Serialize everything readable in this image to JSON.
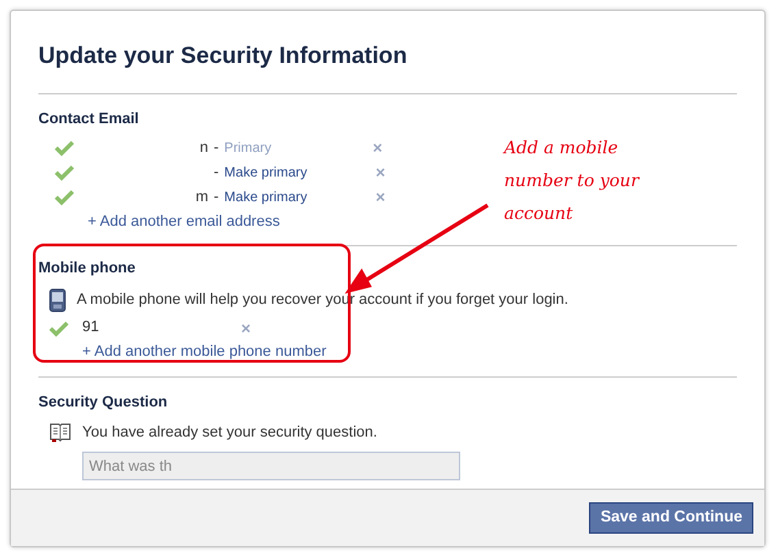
{
  "dialog": {
    "title": "Update your Security Information"
  },
  "contact_email": {
    "heading": "Contact Email",
    "emails": [
      {
        "address": "n",
        "separator": "-",
        "action": "Primary",
        "primary": true,
        "verified": true,
        "remove": "×"
      },
      {
        "separator": "-",
        "action": "Make primary",
        "primary": false,
        "verified": true,
        "remove": "×"
      },
      {
        "address": "m",
        "separator": "-",
        "action": "Make primary",
        "primary": false,
        "verified": true,
        "remove": "×"
      }
    ],
    "add_link": "+ Add another email address"
  },
  "mobile_phone": {
    "heading": "Mobile phone",
    "highlighted": true,
    "info": "A mobile phone will help you recover your account if you forget your login.",
    "numbers": [
      {
        "number": "91",
        "verified": true,
        "remove": "×"
      }
    ],
    "add_link": "+ Add another mobile phone number"
  },
  "security_question": {
    "heading": "Security Question",
    "info": "You have already set your security question.",
    "question_value": "What was th"
  },
  "footer": {
    "button": "Save and Continue"
  },
  "annotation": {
    "note": "Add a mobile number to your account"
  }
}
